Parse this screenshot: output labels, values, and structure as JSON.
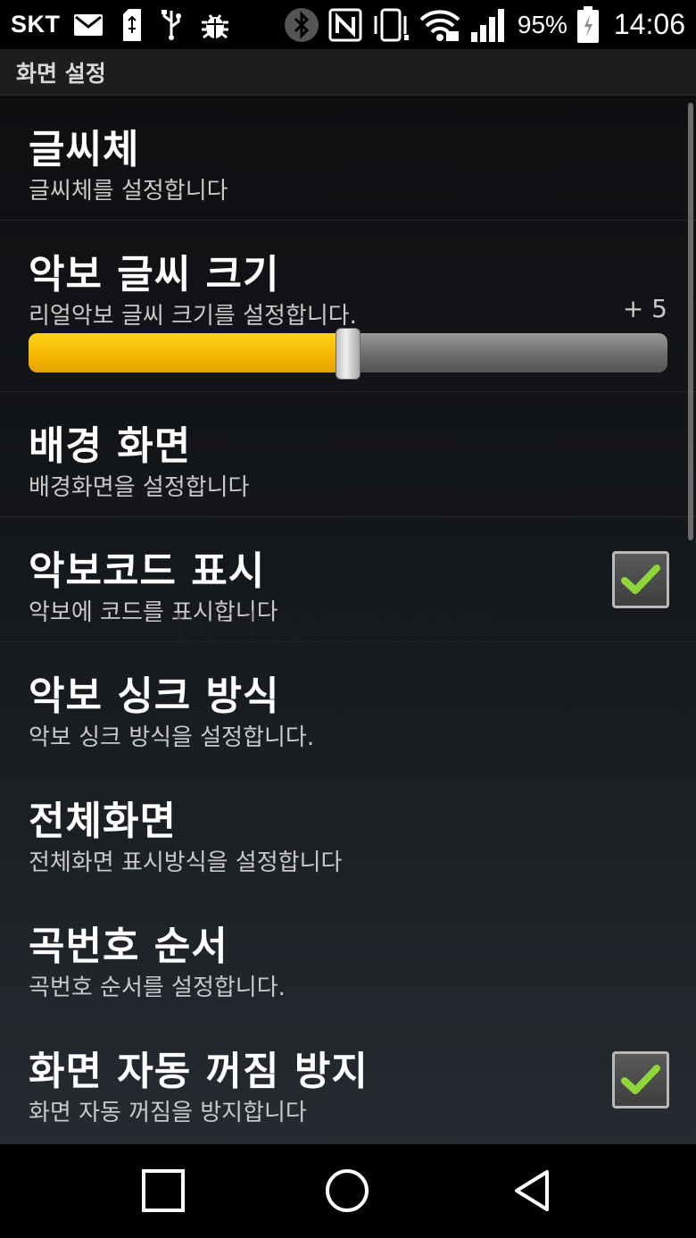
{
  "status_bar": {
    "carrier": "SKT",
    "battery_percent": "95%",
    "time": "14:06",
    "icons_left": [
      "mail-icon",
      "sd-card-icon",
      "usb-icon",
      "debug-bug-icon"
    ],
    "icons_right": [
      "bluetooth-icon",
      "nfc-icon",
      "vibrate-icon",
      "wifi-icon",
      "signal-icon",
      "battery-icon"
    ]
  },
  "section_header": "화면 설정",
  "items": [
    {
      "title": "글씨체",
      "summary": "글씨체를 설정합니다"
    },
    {
      "title": "악보 글씨 크기",
      "summary": "리얼악보 글씨 크기를 설정합니다.",
      "value_label": "+ 5",
      "slider_level": 0.5
    },
    {
      "title": "배경 화면",
      "summary": "배경화면을 설정합니다"
    },
    {
      "title": "악보코드 표시",
      "summary": "악보에 코드를 표시합니다",
      "checked": true
    },
    {
      "title": "악보 싱크 방식",
      "summary": "악보 싱크 방식을 설정합니다."
    },
    {
      "title": "전체화면",
      "summary": "전체화면 표시방식을 설정합니다"
    },
    {
      "title": "곡번호 순서",
      "summary": "곡번호 순서를 설정합니다."
    },
    {
      "title": "화면 자동 꺼짐 방지",
      "summary": "화면 자동 꺼짐을 방지합니다",
      "checked": true
    }
  ],
  "watermark": "UpdateStar.com",
  "nav_bar": [
    "recent-apps-icon",
    "home-icon",
    "back-icon"
  ],
  "colors": {
    "accent": "#f7b800",
    "check": "#8ed63a"
  }
}
